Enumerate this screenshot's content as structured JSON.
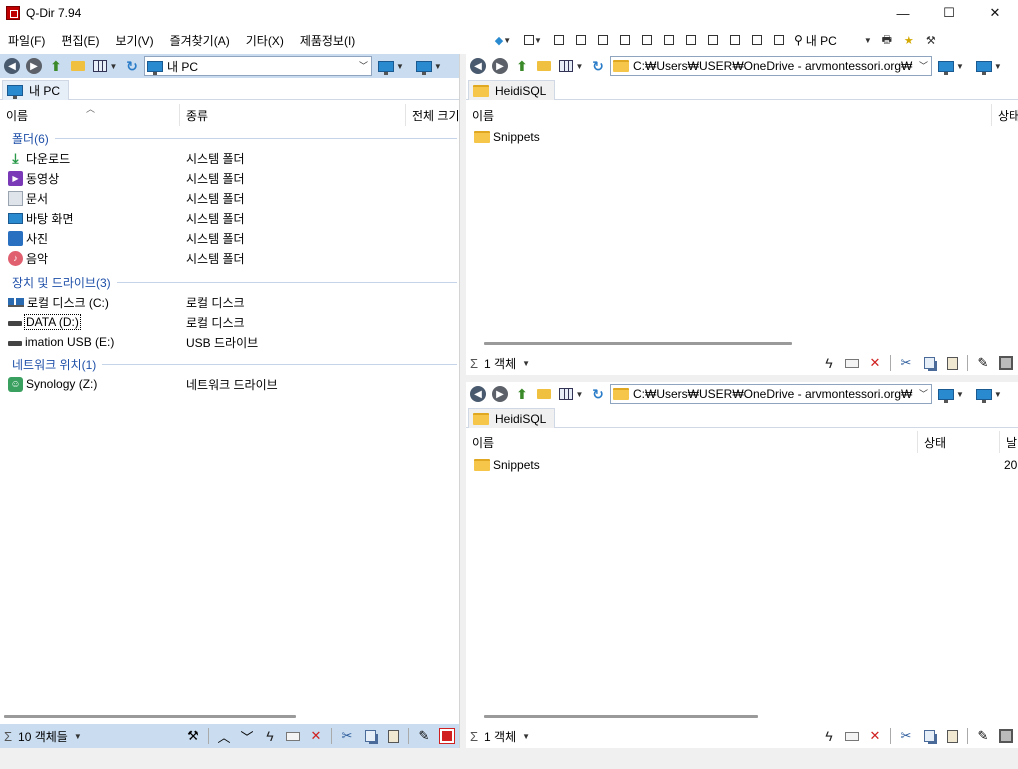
{
  "window": {
    "title": "Q-Dir 7.94",
    "controls": [
      "—",
      "☐",
      "✕"
    ]
  },
  "menu": [
    "파일(F)",
    "편집(E)",
    "보기(V)",
    "즐겨찾기(A)",
    "기타(X)",
    "제품정보(I)"
  ],
  "global_toolbar": {
    "location_label": "내 PC"
  },
  "left_pane": {
    "address": "내 PC",
    "tab_label": "내 PC",
    "columns": [
      "이름",
      "종류",
      "전체 크기"
    ],
    "groups": [
      {
        "header": "폴더(6)",
        "items": [
          {
            "name": "다운로드",
            "type": "시스템 폴더",
            "icon": "download-icon"
          },
          {
            "name": "동영상",
            "type": "시스템 폴더",
            "icon": "video-icon"
          },
          {
            "name": "문서",
            "type": "시스템 폴더",
            "icon": "document-icon"
          },
          {
            "name": "바탕 화면",
            "type": "시스템 폴더",
            "icon": "desktop-icon"
          },
          {
            "name": "사진",
            "type": "시스템 폴더",
            "icon": "pictures-icon"
          },
          {
            "name": "음악",
            "type": "시스템 폴더",
            "icon": "music-icon"
          }
        ]
      },
      {
        "header": "장치 및 드라이브(3)",
        "items": [
          {
            "name": "로컬 디스크 (C:)",
            "type": "로컬 디스크",
            "icon": "system-drive-icon"
          },
          {
            "name": "DATA (D:)",
            "type": "로컬 디스크",
            "icon": "drive-icon"
          },
          {
            "name": "imation USB (E:)",
            "type": "USB 드라이브",
            "icon": "usb-drive-icon"
          }
        ]
      },
      {
        "header": "네트워크 위치(1)",
        "items": [
          {
            "name": "Synology (Z:)",
            "type": "네트워크 드라이브",
            "icon": "network-drive-icon"
          }
        ]
      }
    ],
    "status": "10 객체들"
  },
  "right_top_pane": {
    "address": "C:₩Users₩USER₩OneDrive - arvmontessori.org₩Do",
    "tab_label": "HeidiSQL",
    "columns": [
      "이름",
      "상태"
    ],
    "items": [
      {
        "name": "Snippets"
      }
    ],
    "status": "1 객체"
  },
  "right_bottom_pane": {
    "address": "C:₩Users₩USER₩OneDrive - arvmontessori.org₩Do",
    "tab_label": "HeidiSQL",
    "columns": [
      "이름",
      "상태",
      "날"
    ],
    "items": [
      {
        "name": "Snippets",
        "date": "20"
      }
    ],
    "status": "1 객체"
  },
  "colors": {
    "left_toolbar_bg": "#c9dcf0",
    "group_header": "#1e4fa8",
    "folder": "#f5c64a"
  }
}
